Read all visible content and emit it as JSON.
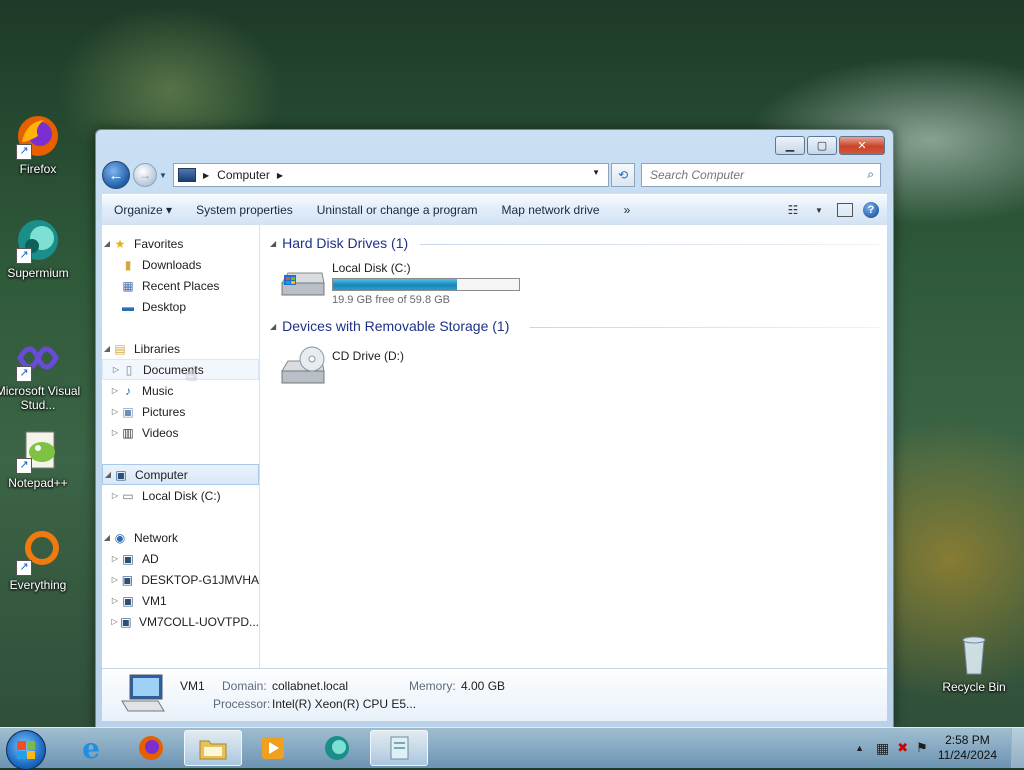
{
  "desktop": {
    "icons": [
      {
        "label": "Firefox",
        "icon": "firefox-icon"
      },
      {
        "label": "Supermium",
        "icon": "supermium-icon"
      },
      {
        "label": "Microsoft Visual Stud...",
        "icon": "visual-studio-icon"
      },
      {
        "label": "Notepad++",
        "icon": "notepadpp-icon"
      },
      {
        "label": "Everything",
        "icon": "everything-icon"
      },
      {
        "label": "Recycle Bin",
        "icon": "recycle-bin-icon"
      }
    ]
  },
  "window": {
    "address": {
      "crumb": "Computer"
    },
    "search": {
      "placeholder": "Search Computer"
    },
    "toolbar": {
      "organize": "Organize ▾",
      "system_properties": "System properties",
      "uninstall": "Uninstall or change a program",
      "map_drive": "Map network drive",
      "more": "»"
    },
    "nav": {
      "favorites": "Favorites",
      "downloads": "Downloads",
      "recent": "Recent Places",
      "desktop": "Desktop",
      "libraries": "Libraries",
      "documents": "Documents",
      "music": "Music",
      "pictures": "Pictures",
      "videos": "Videos",
      "computer": "Computer",
      "local_disk": "Local Disk (C:)",
      "network": "Network",
      "ad": "AD",
      "desktop_pc": "DESKTOP-G1JMVHA",
      "vm1": "VM1",
      "vm7": "VM7COLL-UOVTPD..."
    },
    "groups": {
      "hdd": "Hard Disk Drives (1)",
      "removable": "Devices with Removable Storage (1)"
    },
    "drives": {
      "c_name": "Local Disk (C:)",
      "c_free": "19.9 GB free of 59.8 GB",
      "c_used_fraction": 0.667,
      "d_name": "CD Drive (D:)"
    },
    "details": {
      "name": "VM1",
      "domain_label": "Domain:",
      "domain": "collabnet.local",
      "memory_label": "Memory:",
      "memory": "4.00 GB",
      "processor_label": "Processor:",
      "processor": "Intel(R) Xeon(R) CPU E5..."
    }
  },
  "taskbar": {
    "time": "2:58 PM",
    "date": "11/24/2024"
  },
  "colors": {
    "accent": "#1e3287",
    "selection": "#d8e8f8",
    "bar_fill": "#1b86b9"
  }
}
